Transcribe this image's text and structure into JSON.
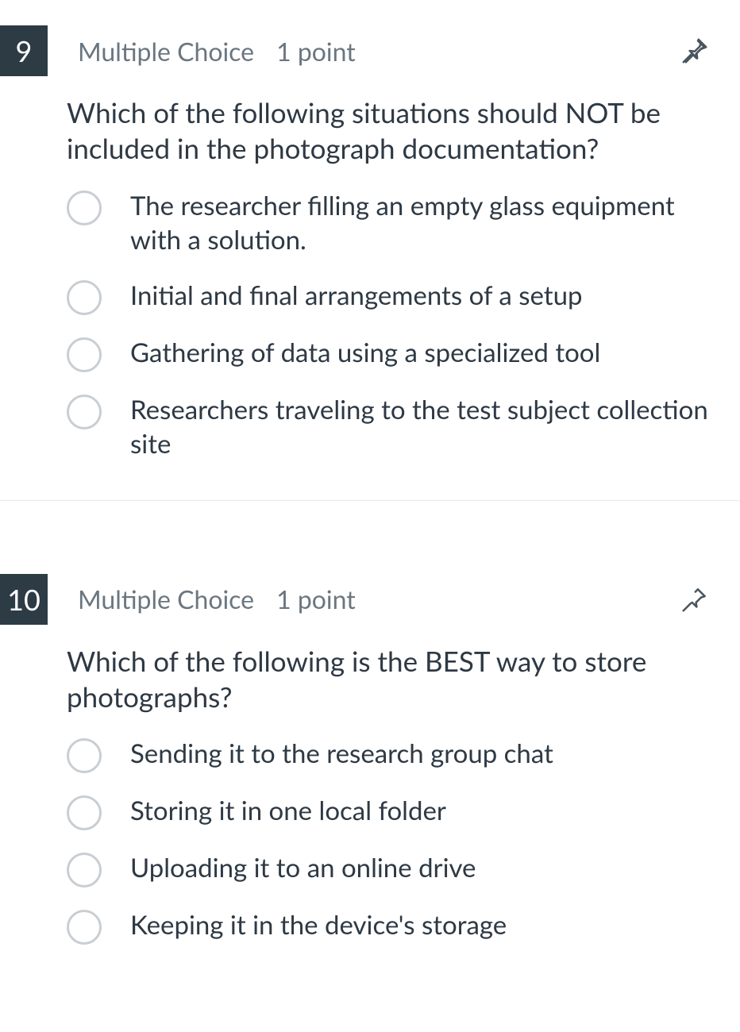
{
  "questions": [
    {
      "number": "9",
      "type_label": "Multiple Choice",
      "points_label": "1 point",
      "prompt": "Which of the following situations should NOT be included in the photograph documentation?",
      "options": [
        "The researcher filling an empty glass equipment with a solution.",
        "Initial and final arrangements of a setup",
        "Gathering of data using a specialized tool",
        "Researchers traveling to the test subject collection site"
      ]
    },
    {
      "number": "10",
      "type_label": "Multiple Choice",
      "points_label": "1 point",
      "prompt": "Which of the following is the BEST way to store photographs?",
      "options": [
        "Sending it to the research group chat",
        "Storing it in one local folder",
        "Uploading it to an online drive",
        "Keeping it in the device's storage"
      ]
    }
  ]
}
